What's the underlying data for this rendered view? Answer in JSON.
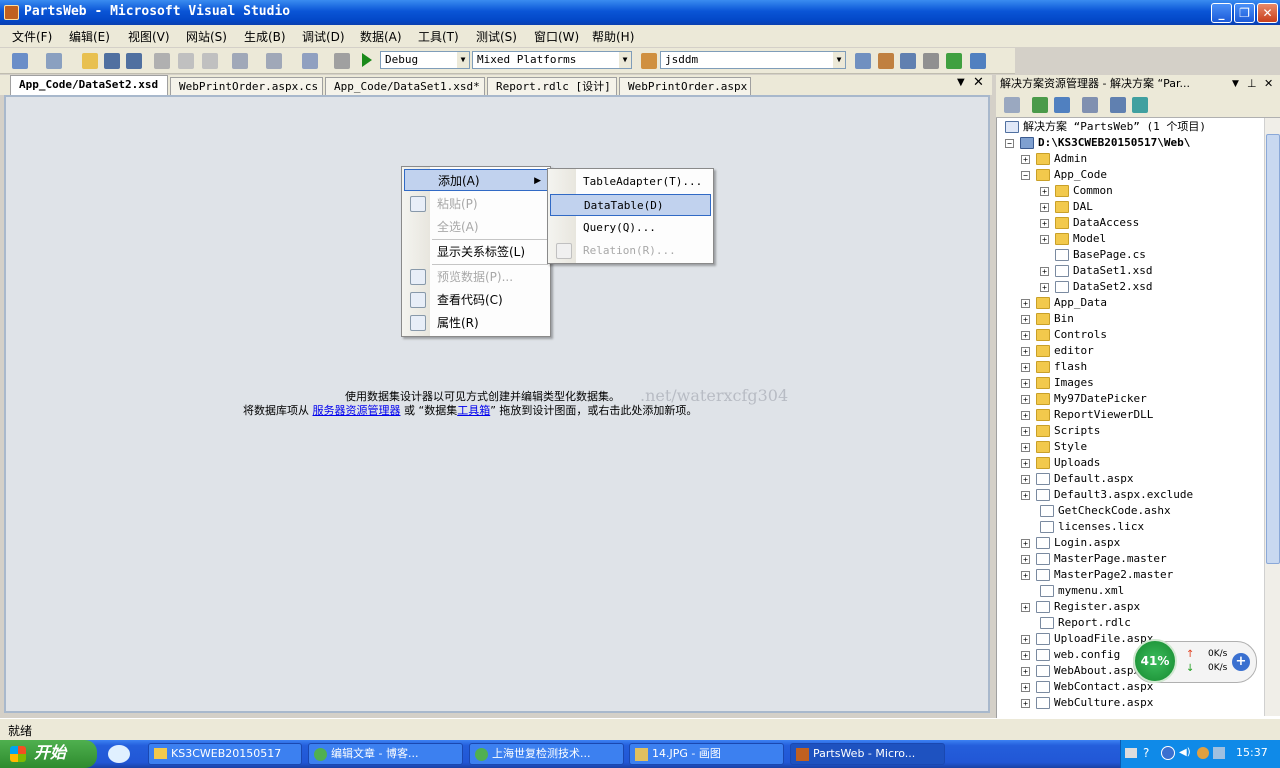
{
  "window": {
    "title": "PartsWeb - Microsoft Visual Studio"
  },
  "menu": [
    "文件(F)",
    "编辑(E)",
    "视图(V)",
    "网站(S)",
    "生成(B)",
    "调试(D)",
    "数据(A)",
    "工具(T)",
    "测试(S)",
    "窗口(W)",
    "帮助(H)"
  ],
  "toolbar": {
    "config": "Debug",
    "platform": "Mixed Platforms",
    "find": "jsddm"
  },
  "tabs": [
    "App_Code/DataSet2.xsd",
    "WebPrintOrder.aspx.cs",
    "App_Code/DataSet1.xsd*",
    "Report.rdlc [设计]",
    "WebPrintOrder.aspx"
  ],
  "designer": {
    "msg1": "使用数据集设计器以可见方式创建并编辑类型化数据集。",
    "msg2_pre": "将数据库项从",
    "msg2_link1": "服务器资源管理器",
    "msg2_mid": "或 “数据集",
    "msg2_link2": "工具箱",
    "msg2_post": "” 拖放到设计图面，或右击此处添加新项。",
    "watermark": ".net/waterxcfg304"
  },
  "context_menu": [
    "添加(A)",
    "粘贴(P)",
    "全选(A)",
    "显示关系标签(L)",
    "预览数据(P)...",
    "查看代码(C)",
    "属性(R)"
  ],
  "submenu": [
    "TableAdapter(T)...",
    "DataTable(D)",
    "Query(Q)...",
    "Relation(R)..."
  ],
  "status": "就绪",
  "solution": {
    "header": "解决方案资源管理器 - 解决方案 “Par...",
    "root": "解决方案 “PartsWeb” (1 个项目)",
    "project": "D:\\KS3CWEB20150517\\Web\\",
    "items": [
      "Admin",
      "App_Code",
      "Common",
      "DAL",
      "DataAccess",
      "Model",
      "BasePage.cs",
      "DataSet1.xsd",
      "DataSet2.xsd",
      "App_Data",
      "Bin",
      "Controls",
      "editor",
      "flash",
      "Images",
      "My97DatePicker",
      "ReportViewerDLL",
      "Scripts",
      "Style",
      "Uploads",
      "Default.aspx",
      "Default3.aspx.exclude",
      "GetCheckCode.ashx",
      "licenses.licx",
      "Login.aspx",
      "MasterPage.master",
      "MasterPage2.master",
      "mymenu.xml",
      "Register.aspx",
      "Report.rdlc",
      "UploadFile.aspx",
      "web.config",
      "WebAbout.aspx",
      "WebContact.aspx",
      "WebCulture.aspx"
    ]
  },
  "taskbar": {
    "start": "开始",
    "tasks": [
      "KS3CWEB20150517",
      "编辑文章 - 博客...",
      "上海世复检测技术...",
      "14.JPG - 画图",
      "PartsWeb - Micro..."
    ],
    "clock": "15:37"
  },
  "net_widget": {
    "percent": "41%",
    "up": "0K/s",
    "down": "0K/s"
  }
}
